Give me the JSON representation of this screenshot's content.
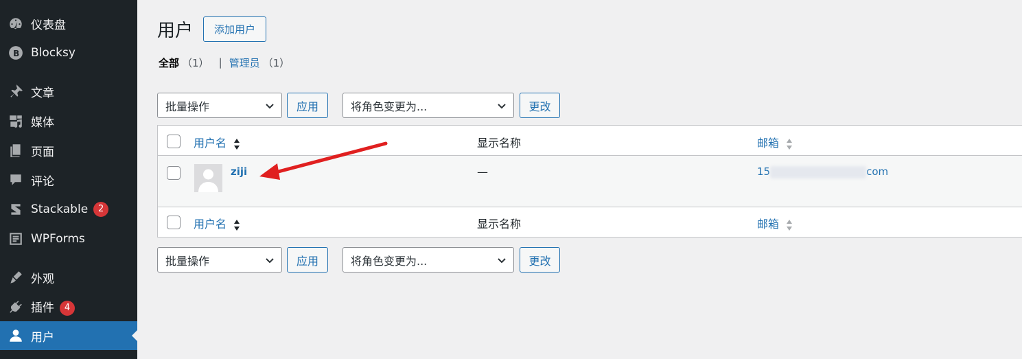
{
  "sidebar": {
    "items": [
      {
        "label": "仪表盘",
        "icon": "dashboard-icon"
      },
      {
        "label": "Blocksy",
        "icon": "blocksy-icon"
      },
      {
        "label": "文章",
        "icon": "pin-icon"
      },
      {
        "label": "媒体",
        "icon": "media-icon"
      },
      {
        "label": "页面",
        "icon": "page-icon"
      },
      {
        "label": "评论",
        "icon": "comment-icon"
      },
      {
        "label": "Stackable",
        "icon": "stackable-icon",
        "badge": "2"
      },
      {
        "label": "WPForms",
        "icon": "wpforms-icon"
      },
      {
        "label": "外观",
        "icon": "brush-icon"
      },
      {
        "label": "插件",
        "icon": "plugin-icon",
        "badge": "4"
      },
      {
        "label": "用户",
        "icon": "user-icon",
        "active": true
      }
    ]
  },
  "header": {
    "title": "用户",
    "add_new": "添加用户"
  },
  "filters": {
    "all_label": "全部",
    "all_count": "（1）",
    "admin_label": "管理员",
    "admin_count": "（1）"
  },
  "bulk": {
    "action_select": "批量操作",
    "apply": "应用",
    "role_select": "将角色变更为...",
    "change": "更改"
  },
  "table": {
    "columns": {
      "username": "用户名",
      "display_name": "显示名称",
      "email": "邮箱"
    },
    "rows": [
      {
        "username": "ziji",
        "display_name": "—",
        "email_prefix": "15",
        "email_suffix": "com"
      }
    ]
  },
  "colors": {
    "sidebar_bg": "#1d2327",
    "active": "#2271b1",
    "badge": "#d63638",
    "annotation_arrow": "#e02020"
  }
}
